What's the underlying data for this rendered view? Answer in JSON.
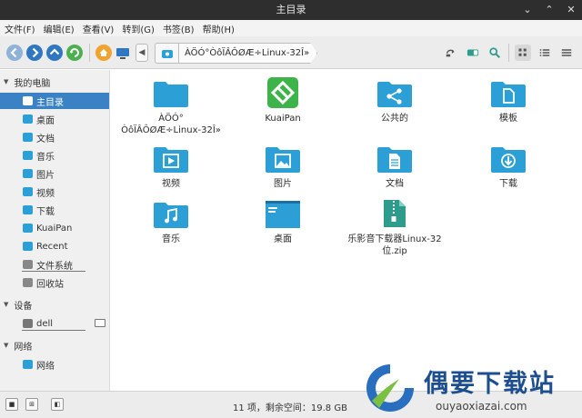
{
  "window": {
    "title": "主目录",
    "controls": [
      "⌄",
      "⌃",
      "✕"
    ]
  },
  "menu": [
    "文件(F)",
    "编辑(E)",
    "查看(V)",
    "转到(G)",
    "书签(B)",
    "帮助(H)"
  ],
  "breadcrumb": {
    "path": "ÀÖÓ°ÒôÏÂÔØÆ÷Linux-32Î»"
  },
  "sidebar": {
    "sections": [
      {
        "title": "我的电脑",
        "items": [
          "主目录",
          "桌面",
          "文档",
          "音乐",
          "图片",
          "视频",
          "下载",
          "KuaiPan",
          "Recent",
          "文件系统",
          "回收站"
        ]
      },
      {
        "title": "设备",
        "items": [
          "dell"
        ]
      },
      {
        "title": "网络",
        "items": [
          "网络"
        ]
      }
    ],
    "selected": "主目录"
  },
  "files": [
    {
      "name": "ÀÖÓ°\nÒôÏÂÔØÆ÷Linux-32Î»",
      "icon": "folder-icon"
    },
    {
      "name": "KuaiPan",
      "icon": "kuaipan-icon"
    },
    {
      "name": "公共的",
      "icon": "share-folder-icon"
    },
    {
      "name": "模板",
      "icon": "template-folder-icon"
    },
    {
      "name": "视频",
      "icon": "video-folder-icon"
    },
    {
      "name": "图片",
      "icon": "picture-folder-icon"
    },
    {
      "name": "文档",
      "icon": "document-folder-icon"
    },
    {
      "name": "下载",
      "icon": "download-folder-icon"
    },
    {
      "name": "音乐",
      "icon": "music-folder-icon"
    },
    {
      "name": "桌面",
      "icon": "desktop-folder-icon"
    },
    {
      "name": "乐影音下载器Linux-32\n位.zip",
      "icon": "zip-archive-icon"
    }
  ],
  "status": {
    "text": "11 项，剩余空间：19.8 GB"
  },
  "watermark": {
    "title": "偶要下载站",
    "url": "ouyaoxiazai.com"
  },
  "colors": {
    "accent": "#2ca0d6",
    "selection": "#3a82c4",
    "kuaipan": "#3db34a",
    "zip": "#2e9c8c",
    "brand": "#1d4e8f"
  }
}
